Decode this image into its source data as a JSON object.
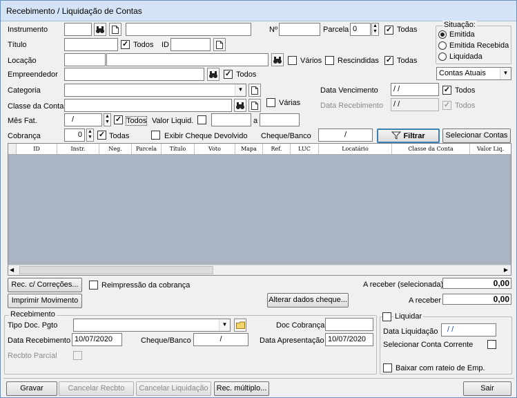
{
  "window": {
    "title": "Recebimento / Liquidação de Contas"
  },
  "filters": {
    "instrumento_label": "Instrumento",
    "numero_label": "Nº",
    "parcela_label": "Parcela",
    "parcela_value": "0",
    "todas_label": "Todas",
    "titulo_label": "Título",
    "todos_label": "Todos",
    "id_label": "ID",
    "locacao_label": "Locação",
    "varios_label": "Vários",
    "rescindidas_label": "Rescindidas",
    "empreendedor_label": "Empreendedor",
    "categoria_label": "Categoria",
    "classe_conta_label": "Classe da Conta",
    "varias_label": "Várias",
    "mes_fat_label": "Mês Fat.",
    "mes_fat_value": "/",
    "valor_liquid_label": "Valor Liquid.",
    "a_label": "a",
    "cobranca_label": "Cobrança",
    "cobranca_value": "0",
    "exibir_cheque_label": "Exibir Cheque Devolvido",
    "cheque_banco_label": "Cheque/Banco",
    "cheque_banco_value": "/",
    "data_vencimento_label": "Data Vencimento",
    "data_vencimento_value": "/ /",
    "data_recebimento_label": "Data Recebimento",
    "data_recebimento_value": "/ /"
  },
  "situacao": {
    "title": "Situação:",
    "options": [
      "Emitida",
      "Emitida Recebida",
      "Liquidada"
    ],
    "selected": "Emitida",
    "contas_select": "Contas Atuais"
  },
  "buttons": {
    "filtrar": "Filtrar",
    "selecionar_contas": "Selecionar Contas",
    "rec_correcoes": "Rec. c/ Correções...",
    "imprimir_movimento": "Imprimir Movimento",
    "alterar_cheque": "Alterar dados cheque...",
    "gravar": "Gravar",
    "cancelar_recbto": "Cancelar Recbto",
    "cancelar_liquidacao": "Cancelar Liquidação",
    "rec_multiplo": "Rec. múltiplo...",
    "sair": "Sair"
  },
  "grid": {
    "columns": [
      "ID",
      "Instr.",
      "Neg.",
      "Parcela",
      "Título",
      "Voto",
      "Mapa",
      "Ref.",
      "LUC",
      "Locatário",
      "Classe da Conta",
      "Valor Liq."
    ]
  },
  "summary": {
    "reimpressao_label": "Reimpressão da cobrança",
    "a_receber_sel_label": "A receber (selecionada)",
    "a_receber_sel_value": "0,00",
    "a_receber_label": "A receber",
    "a_receber_value": "0,00"
  },
  "recebimento": {
    "title": "Recebimento",
    "tipo_doc_label": "Tipo Doc. Pgto",
    "doc_cobranca_label": "Doc Cobrança",
    "data_recebimento_label": "Data Recebimento",
    "data_recebimento_value": "10/07/2020",
    "cheque_banco_label": "Cheque/Banco",
    "cheque_banco_value": "/",
    "data_apresentacao_label": "Data Apresentação",
    "data_apresentacao_value": "10/07/2020",
    "recbto_parcial_label": "Recbto Parcial"
  },
  "liquidar": {
    "title": "Liquidar",
    "data_liquidacao_label": "Data Liquidação",
    "data_liquidacao_value": "/ /",
    "selecionar_conta_label": "Selecionar Conta Corrente",
    "baixar_rateio_label": "Baixar com rateio de Emp."
  },
  "icons": {
    "binoculars": "binoculars-icon",
    "page": "page-icon",
    "folder": "folder-icon",
    "funnel": "funnel-icon"
  }
}
